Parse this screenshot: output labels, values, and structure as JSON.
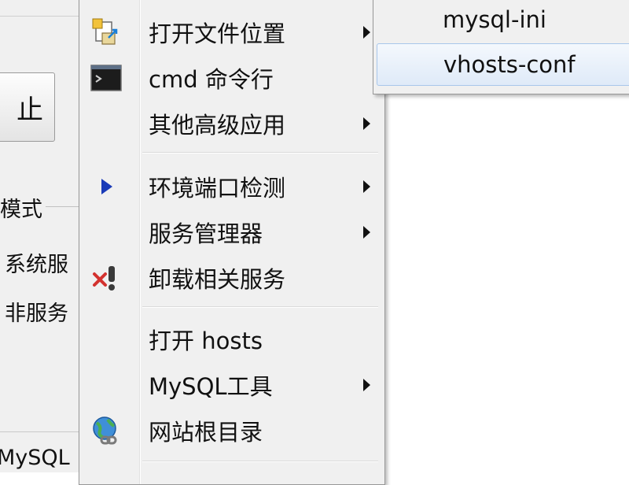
{
  "background_window": {
    "button_label": "止",
    "group_title": "模式",
    "radio_1": "系统服",
    "radio_2": "非服务",
    "status_text": "MySQL"
  },
  "context_menu": {
    "items": [
      {
        "label": "打开文件位置",
        "icon": "folder-link-icon",
        "has_submenu": true
      },
      {
        "label": "cmd 命令行",
        "icon": "console-icon",
        "has_submenu": false
      },
      {
        "label": "其他高级应用",
        "icon": "",
        "has_submenu": true
      },
      {
        "label": "环境端口检测",
        "icon": "play-triangle-icon",
        "has_submenu": true
      },
      {
        "label": "服务管理器",
        "icon": "",
        "has_submenu": true
      },
      {
        "label": "卸载相关服务",
        "icon": "remove-warning-icon",
        "has_submenu": false
      },
      {
        "label": "打开 hosts",
        "icon": "",
        "has_submenu": false
      },
      {
        "label": "MySQL工具",
        "icon": "",
        "has_submenu": true
      },
      {
        "label": "网站根目录",
        "icon": "globe-link-icon",
        "has_submenu": false
      }
    ]
  },
  "submenu": {
    "items": [
      {
        "label": "mysql-ini",
        "highlighted": false
      },
      {
        "label": "vhosts-conf",
        "highlighted": true
      }
    ]
  },
  "colors": {
    "menu_background": "#f0f0f0",
    "highlight_border": "#a8c6ea",
    "accent_blue": "#1a3bb8"
  }
}
